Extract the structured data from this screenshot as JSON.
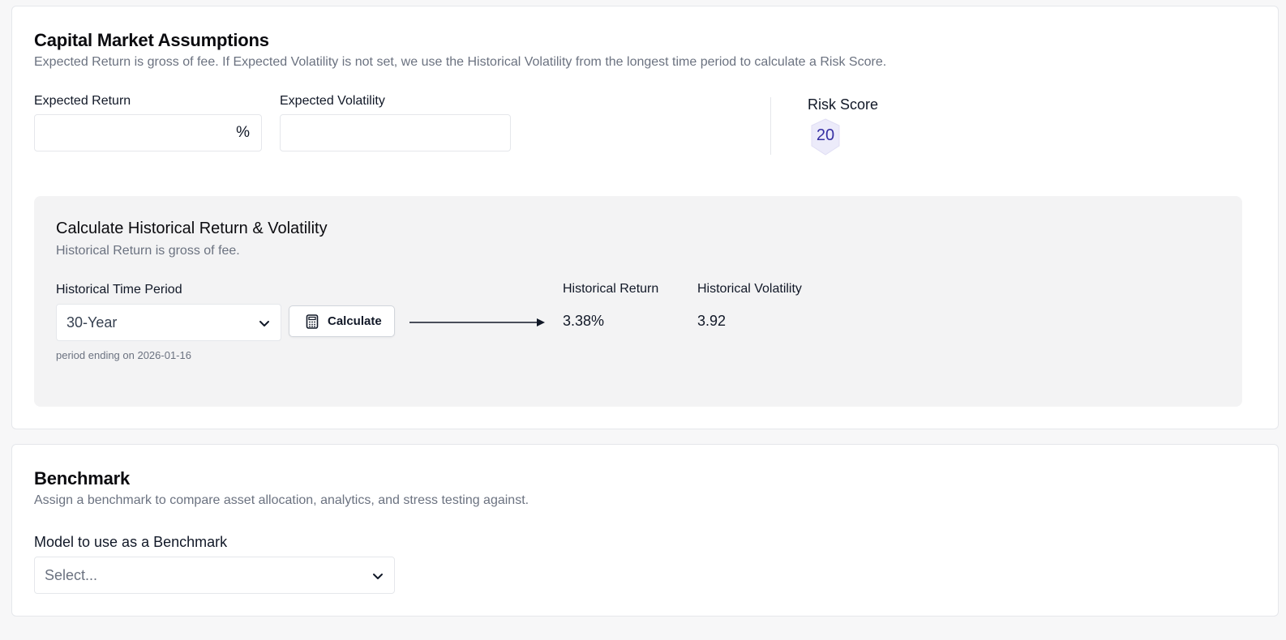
{
  "cma": {
    "title": "Capital Market Assumptions",
    "description": "Expected Return is gross of fee. If Expected Volatility is not set, we use the Historical Volatility from the longest time period to calculate a Risk Score.",
    "expected_return_label": "Expected Return",
    "expected_return_value": "",
    "expected_return_suffix": "%",
    "expected_volatility_label": "Expected Volatility",
    "expected_volatility_value": "",
    "risk_score_label": "Risk Score",
    "risk_score_value": "20"
  },
  "historical": {
    "title": "Calculate Historical Return & Volatility",
    "description": "Historical Return is gross of fee.",
    "time_period_label": "Historical Time Period",
    "time_period_value": "30-Year",
    "calculate_label": "Calculate",
    "period_note": "period ending on 2026-01-16",
    "return_label": "Historical Return",
    "return_value": "3.38%",
    "volatility_label": "Historical Volatility",
    "volatility_value": "3.92"
  },
  "benchmark": {
    "title": "Benchmark",
    "description": "Assign a benchmark to compare asset allocation, analytics, and stress testing against.",
    "model_label": "Model to use as a Benchmark",
    "model_placeholder": "Select..."
  },
  "icons": {
    "chevron": "chevron-down-icon",
    "calculator": "calculator-icon",
    "arrow": "arrow-right-icon",
    "risk_badge": "shield-badge-icon"
  },
  "colors": {
    "panel_bg": "#f3f3f4",
    "badge_fill": "#ecebfa",
    "badge_text": "#3730a3",
    "muted_text": "#6b7280"
  }
}
